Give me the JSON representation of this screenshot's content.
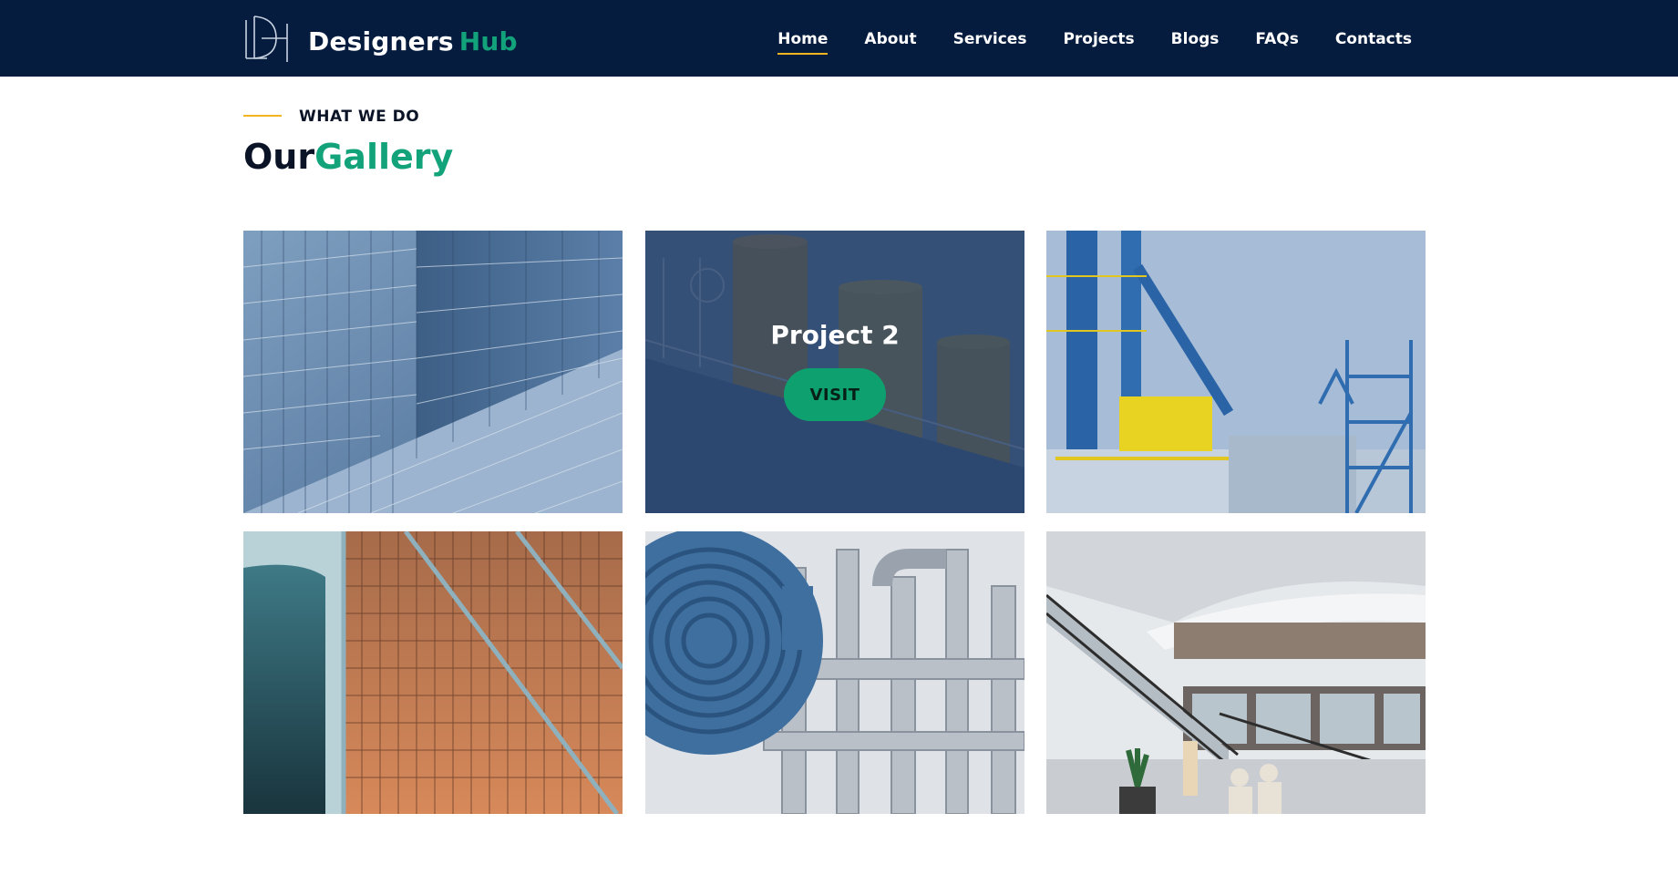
{
  "header": {
    "brand_main": "Designers",
    "brand_accent": "Hub",
    "logo_icon": "dh-monogram-logo",
    "nav": [
      {
        "label": "Home",
        "active": true
      },
      {
        "label": "About"
      },
      {
        "label": "Services"
      },
      {
        "label": "Projects"
      },
      {
        "label": "Blogs"
      },
      {
        "label": "FAQs"
      },
      {
        "label": "Contacts"
      }
    ]
  },
  "section": {
    "eyebrow": "WHAT WE DO",
    "title_main": "Our",
    "title_accent": "Gallery"
  },
  "gallery": {
    "hovered_project": {
      "title": "Project 2",
      "button_label": "VISIT"
    }
  },
  "colors": {
    "navbar_bg": "#051c3f",
    "accent_green": "#12a37a",
    "accent_yellow": "#f2b520",
    "overlay_blue": "#254068"
  }
}
